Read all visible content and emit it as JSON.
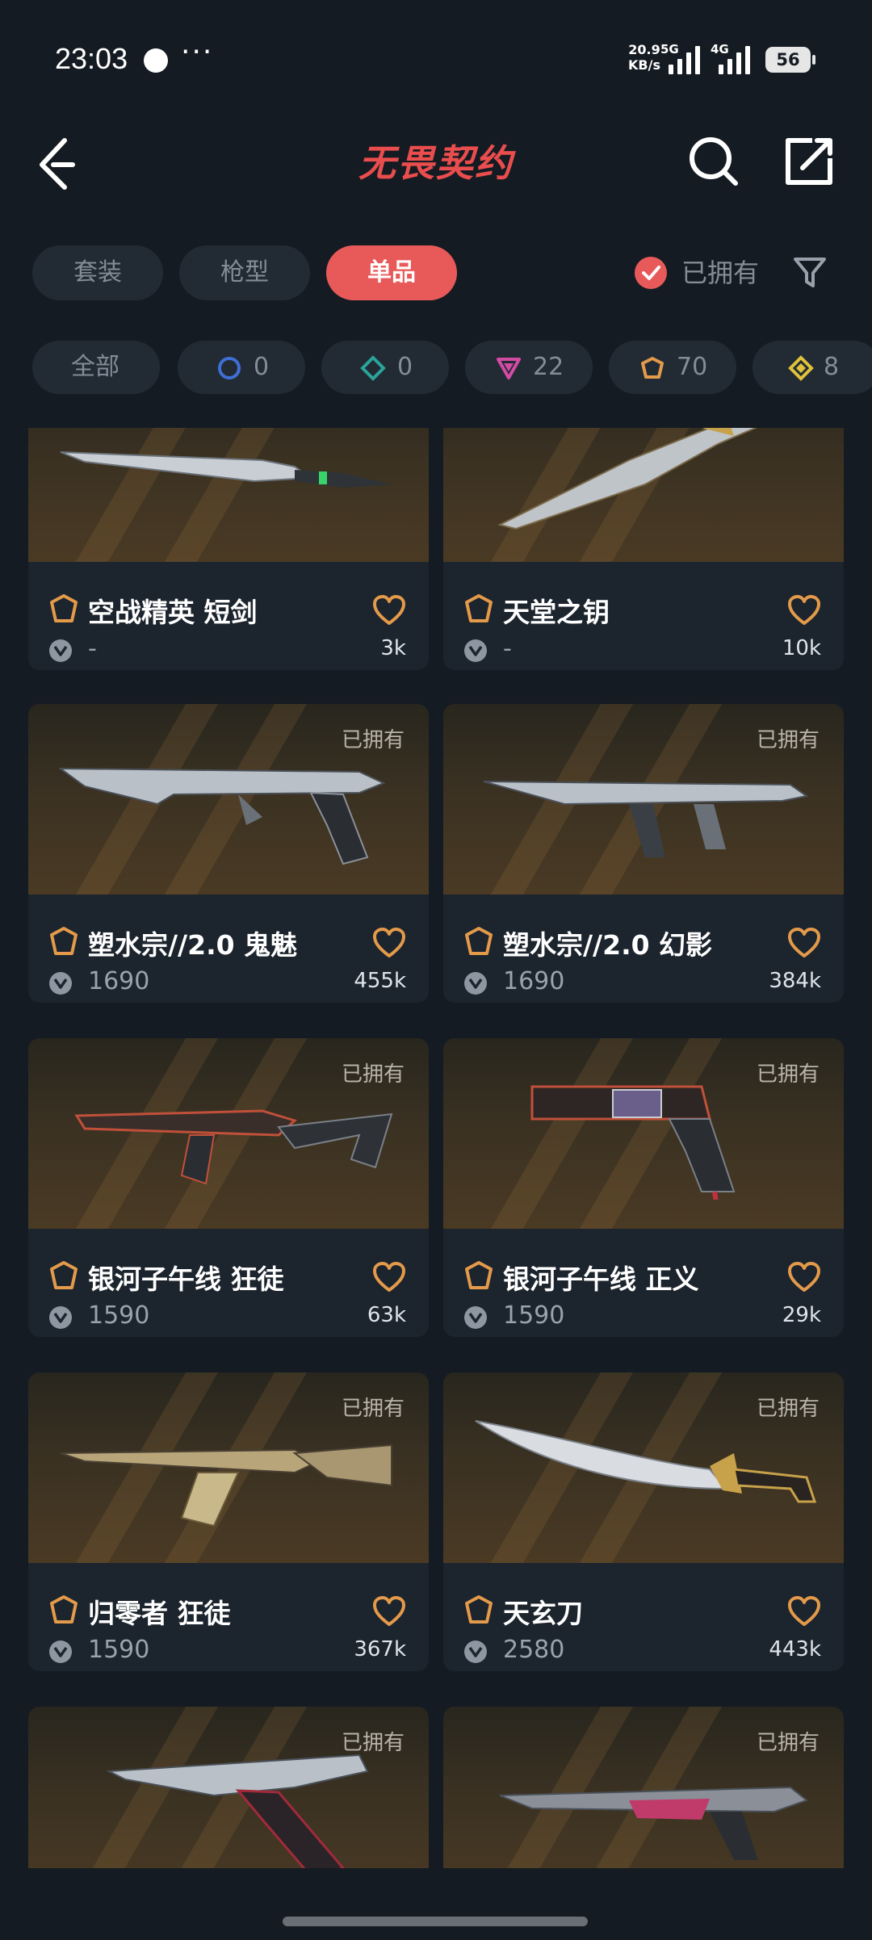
{
  "status_bar": {
    "time": "23:03",
    "more": "···",
    "net_speed_value": "20.9",
    "net_speed_unit": "KB/s",
    "net_5g": "5G",
    "net_4g": "4G",
    "battery": "56"
  },
  "header": {
    "title": "无畏契约",
    "back_icon": "back-arrow-icon",
    "search_icon": "search-icon",
    "share_icon": "share-icon"
  },
  "tabs": [
    {
      "label": "套装",
      "active": false
    },
    {
      "label": "枪型",
      "active": false
    },
    {
      "label": "单品",
      "active": true
    }
  ],
  "owned_filter": {
    "label": "已拥有",
    "checked": true
  },
  "filter_icon": "funnel-icon",
  "tiers": [
    {
      "label": "全部",
      "count": "",
      "color": ""
    },
    {
      "label": "",
      "count": "0",
      "color": "#3f6fd6"
    },
    {
      "label": "",
      "count": "0",
      "color": "#2aa39a"
    },
    {
      "label": "",
      "count": "22",
      "color": "#d34ba5"
    },
    {
      "label": "",
      "count": "70",
      "color": "#e39a4a"
    },
    {
      "label": "",
      "count": "8",
      "color": "#e0c23a"
    }
  ],
  "owned_tag": "已拥有",
  "cards": [
    {
      "name": "空战精英 短剑",
      "price": "-",
      "likes": "3k",
      "owned": false
    },
    {
      "name": "天堂之钥",
      "price": "-",
      "likes": "10k",
      "owned": false
    },
    {
      "name": "塑水宗//2.0 鬼魅",
      "price": "1690",
      "likes": "455k",
      "owned": true
    },
    {
      "name": "塑水宗//2.0 幻影",
      "price": "1690",
      "likes": "384k",
      "owned": true
    },
    {
      "name": "银河子午线 狂徒",
      "price": "1590",
      "likes": "63k",
      "owned": true
    },
    {
      "name": "银河子午线 正义",
      "price": "1590",
      "likes": "29k",
      "owned": true
    },
    {
      "name": "归零者 狂徒",
      "price": "1590",
      "likes": "367k",
      "owned": true
    },
    {
      "name": "天玄刀",
      "price": "2580",
      "likes": "443k",
      "owned": true
    },
    {
      "name": "",
      "price": "",
      "likes": "",
      "owned": true
    },
    {
      "name": "",
      "price": "",
      "likes": "",
      "owned": true
    }
  ],
  "colors": {
    "accent": "#e85a5a",
    "background": "#151b22",
    "card": "#1c242d"
  }
}
